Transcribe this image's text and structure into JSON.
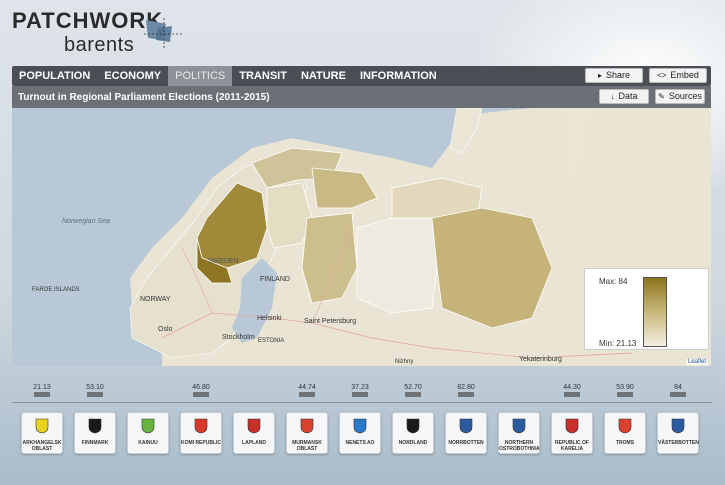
{
  "logo": {
    "top": "PATCHWORK",
    "bottom": "barents"
  },
  "nav": {
    "items": [
      "POPULATION",
      "ECONOMY",
      "POLITICS",
      "TRANSIT",
      "NATURE",
      "INFORMATION"
    ],
    "active": "POLITICS",
    "share": "Share",
    "embed": "Embed"
  },
  "titlebar": {
    "title": "Turnout in Regional Parliament Elections (2011-2015)",
    "data": "Data",
    "sources": "Sources"
  },
  "map": {
    "labels": {
      "norwegian_sea": "Norwegian Sea",
      "faroe": "FAROE ISLANDS",
      "norway": "NORWAY",
      "sweden": "SWEDEN",
      "finland": "FINLAND",
      "estonia": "ESTONIA",
      "oslo": "Oslo",
      "stockholm": "Stockholm",
      "helsinki": "Helsinki",
      "st_petersburg": "Saint Petersburg",
      "nizhny": "Nizhny",
      "yekaterinburg": "Yekaterinburg"
    },
    "legend": {
      "max": "Max: 84",
      "min": "Min: 21.13",
      "color_max": "#8d7521",
      "color_min": "#f3efe2"
    },
    "attribution": "Leaflet"
  },
  "regions": [
    {
      "name": "ARKHANGELSK OBLAST",
      "value": "21.13",
      "fraction": 0.0
    },
    {
      "name": "FINNMARK",
      "value": "53.10",
      "fraction": 0.51
    },
    {
      "name": "KAINUU",
      "value": "",
      "fraction": 0.0
    },
    {
      "name": "KOMI REPUBLIC",
      "value": "46.80",
      "fraction": 0.41
    },
    {
      "name": "LAPLAND",
      "value": "",
      "fraction": 0.0
    },
    {
      "name": "MURMANSK OBLAST",
      "value": "44.74",
      "fraction": 0.37
    },
    {
      "name": "NENETS AO",
      "value": "37.23",
      "fraction": 0.25
    },
    {
      "name": "NORDLAND",
      "value": "52.70",
      "fraction": 0.5
    },
    {
      "name": "NORRBOTTEN",
      "value": "82.80",
      "fraction": 0.98
    },
    {
      "name": "NORTHERN OSTROBOTHNIA",
      "value": "",
      "fraction": 0.0
    },
    {
      "name": "REPUBLIC OF KARELIA",
      "value": "44.30",
      "fraction": 0.37
    },
    {
      "name": "TROMS",
      "value": "53.90",
      "fraction": 0.52
    },
    {
      "name": "VÄSTERBOTTEN",
      "value": "84",
      "fraction": 1.0
    }
  ]
}
